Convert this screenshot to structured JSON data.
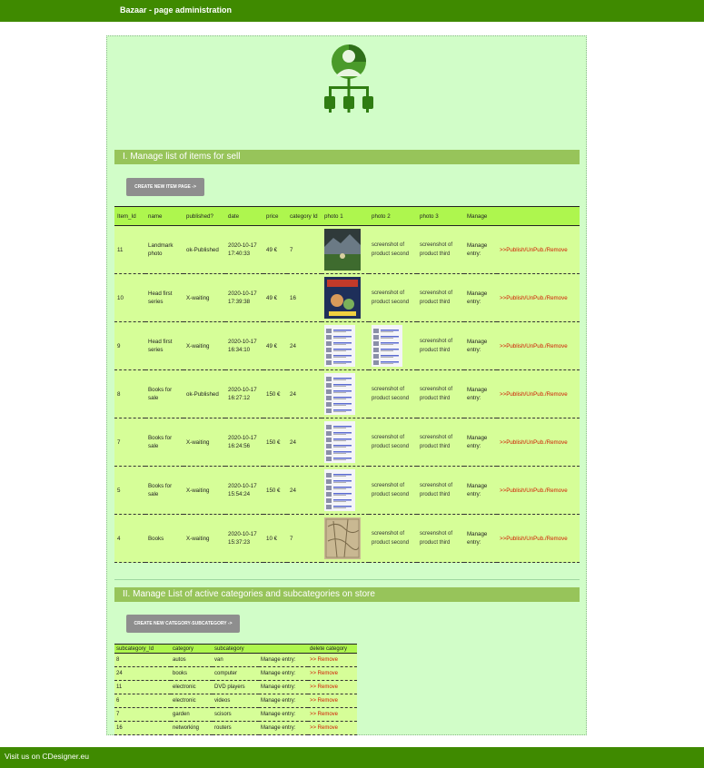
{
  "header": {
    "title": "Bazaar - page administration"
  },
  "colors": {
    "bar": "#3f8a00",
    "panel": "#d1fdc8",
    "section": "#97c45a",
    "header_row": "#aef64e",
    "row": "#d6fe98",
    "link": "#d01a00"
  },
  "section1": {
    "title": "I. Manage list of items for sell",
    "create_button": "create new item page ->",
    "columns": [
      "Item_Id",
      "name",
      "published?",
      "date",
      "price",
      "category Id",
      "photo 1",
      "photo 2",
      "photo 3",
      "Manage",
      ""
    ],
    "rows": [
      {
        "id": "11",
        "name": "Landmark photo",
        "published": "ok-Published",
        "date": "2020-10-17 17:40:33",
        "price": "49 €",
        "category": "7",
        "photo1": "landscape",
        "photo2": "screenshot of product second",
        "photo3": "screenshot of product third",
        "manage": "Manage entry:",
        "action": ">>Publish/UnPub./Remove"
      },
      {
        "id": "10",
        "name": "Head first series",
        "published": "X-waiting",
        "date": "2020-10-17 17:39:38",
        "price": "49 €",
        "category": "16",
        "photo1": "book",
        "photo2": "screenshot of product second",
        "photo3": "screenshot of product third",
        "manage": "Manage entry:",
        "action": ">>Publish/UnPub./Remove"
      },
      {
        "id": "9",
        "name": "Head first series",
        "published": "X-waiting",
        "date": "2020-10-17 16:34:10",
        "price": "49 €",
        "category": "24",
        "photo1": "list",
        "photo2": "list",
        "photo3": "screenshot of product third",
        "manage": "Manage entry:",
        "action": ">>Publish/UnPub./Remove"
      },
      {
        "id": "8",
        "name": "Books for sale",
        "published": "ok-Published",
        "date": "2020-10-17 16:27:12",
        "price": "150 €",
        "category": "24",
        "photo1": "list",
        "photo2": "screenshot of product second",
        "photo3": "screenshot of product third",
        "manage": "Manage entry:",
        "action": ">>Publish/UnPub./Remove"
      },
      {
        "id": "7",
        "name": "Books for sale",
        "published": "X-waiting",
        "date": "2020-10-17 16:24:56",
        "price": "150 €",
        "category": "24",
        "photo1": "list",
        "photo2": "screenshot of product second",
        "photo3": "screenshot of product third",
        "manage": "Manage entry:",
        "action": ">>Publish/UnPub./Remove"
      },
      {
        "id": "5",
        "name": "Books for sale",
        "published": "X-waiting",
        "date": "2020-10-17 15:54:24",
        "price": "150 €",
        "category": "24",
        "photo1": "list",
        "photo2": "screenshot of product second",
        "photo3": "screenshot of product third",
        "manage": "Manage entry:",
        "action": ">>Publish/UnPub./Remove"
      },
      {
        "id": "4",
        "name": "Books",
        "published": "X-waiting",
        "date": "2020-10-17 15:37:23",
        "price": "10 €",
        "category": "7",
        "photo1": "map",
        "photo2": "screenshot of product second",
        "photo3": "screenshot of product third",
        "manage": "Manage entry:",
        "action": ">>Publish/UnPub./Remove"
      }
    ]
  },
  "section2": {
    "title": "II. Manage List of active categories and subcategories on store",
    "create_button": "create new category-subcategory ->",
    "columns": [
      "subcategory_Id",
      "category",
      "subcategory",
      "",
      "delete category"
    ],
    "rows": [
      {
        "id": "8",
        "category": "autos",
        "subcategory": "van",
        "manage": "Manage entry:",
        "action": ">> Remove"
      },
      {
        "id": "24",
        "category": "books",
        "subcategory": "computer",
        "manage": "Manage entry:",
        "action": ">> Remove"
      },
      {
        "id": "11",
        "category": "electronic",
        "subcategory": "DVD players",
        "manage": "Manage entry:",
        "action": ">> Remove"
      },
      {
        "id": "6",
        "category": "electronic",
        "subcategory": "videos",
        "manage": "Manage entry:",
        "action": ">> Remove"
      },
      {
        "id": "7",
        "category": "garden",
        "subcategory": "scisors",
        "manage": "Manage entry:",
        "action": ">> Remove"
      },
      {
        "id": "16",
        "category": "networking",
        "subcategory": "routers",
        "manage": "Manage entry:",
        "action": ">> Remove"
      }
    ]
  },
  "footer": {
    "link": "Visit us on CDesigner.eu"
  }
}
